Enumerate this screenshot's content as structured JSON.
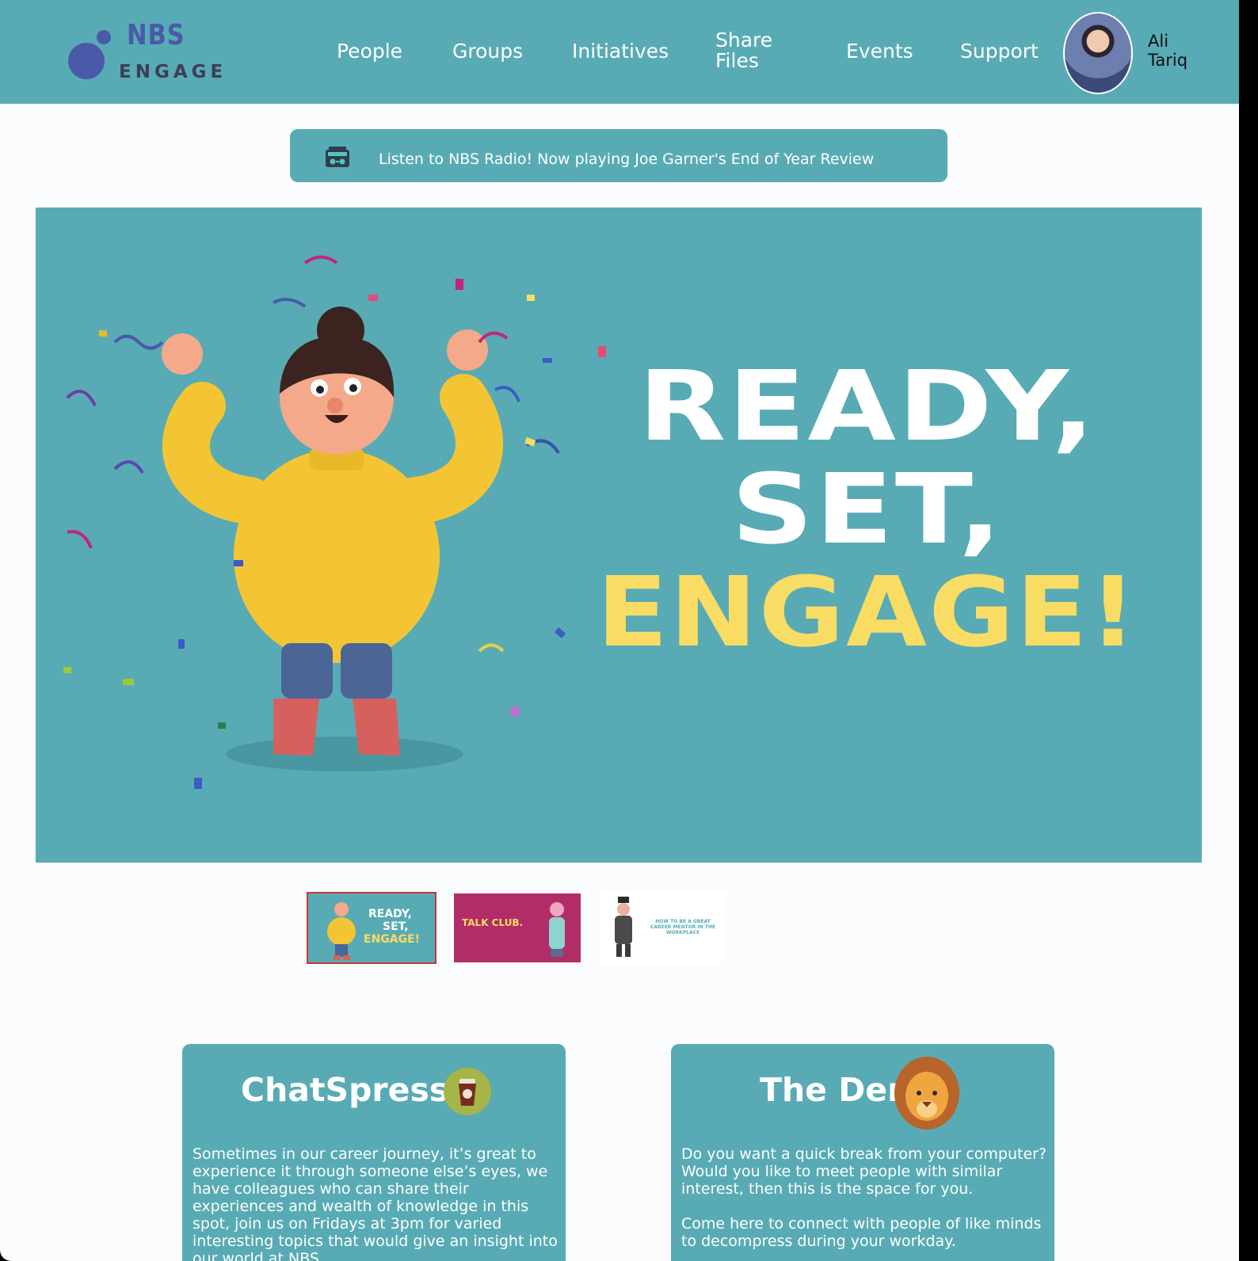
{
  "nav": {
    "logo_top": "NBS",
    "logo_bottom": "ENGAGE",
    "links": [
      "People",
      "Groups",
      "Initiatives",
      "Share Files",
      "Events",
      "Support"
    ],
    "user": {
      "first": "Ali",
      "last": "Tariq"
    }
  },
  "radio": {
    "text": "Listen to NBS Radio! Now playing Joe Garner's End of Year Review"
  },
  "hero": {
    "line1": "READY,",
    "line2": "SET,",
    "line3": "ENGAGE!"
  },
  "thumbnails": [
    {
      "line1": "READY,",
      "line2": "SET,",
      "line3": "ENGAGE!"
    },
    {
      "title": "TALK CLUB."
    },
    {
      "title": "HOW TO BE A GREAT CAREER MENTOR IN THE WORKPLACE"
    }
  ],
  "cards": [
    {
      "title": "ChatSpresso",
      "paragraphs": [
        "Sometimes in our career journey, it’s great to experience it through someone else’s eyes, we have colleagues who can share their experiences and wealth of knowledge in this spot, join us on Fridays at 3pm for varied interesting topics that would give an insight into our world at NBS."
      ]
    },
    {
      "title": "The Den",
      "paragraphs": [
        "Do you want a quick break from your computer? Would you like to meet people with similar interest, then this is the space for you.",
        "Come here to connect with people of like minds to decompress during your workday."
      ]
    }
  ],
  "colors": {
    "teal": "#58abb4",
    "yellow": "#f9dc64",
    "logo_blue": "#4a5aa8",
    "magenta": "#b22c68"
  }
}
